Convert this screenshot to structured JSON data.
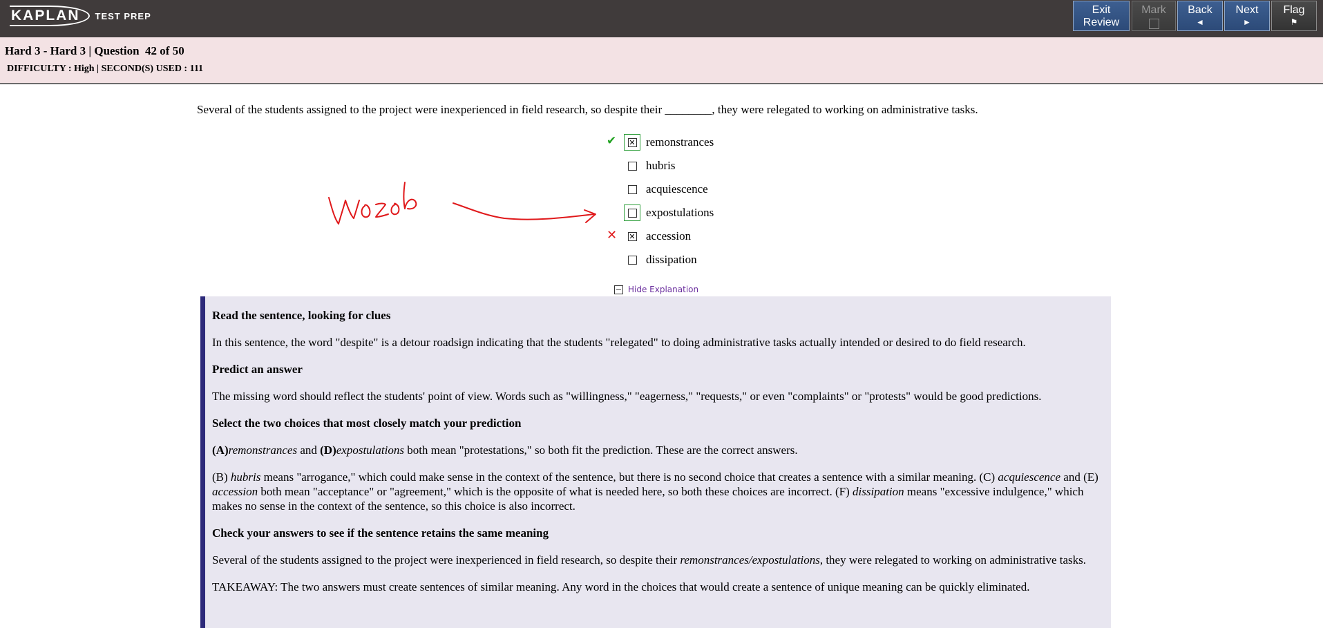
{
  "logo": {
    "main": "KAPLAN",
    "sub": "TEST PREP"
  },
  "toolbar": {
    "exit_line1": "Exit",
    "exit_line2": "Review",
    "mark": "Mark",
    "back": "Back",
    "back_icon": "◄",
    "next": "Next",
    "next_icon": "►",
    "flag": "Flag",
    "flag_icon": "⚑"
  },
  "info": {
    "title": "Hard 3 - Hard 3 | Question  42 of 50",
    "meta": "DIFFICULTY : High | SECOND(S) USED : 111"
  },
  "question": {
    "stem": "Several of the students assigned to the project were inexperienced in field research, so despite their ________, they were relegated to working on administrative tasks.",
    "choices": [
      {
        "label": "remonstrances",
        "checked": true,
        "status": "correct"
      },
      {
        "label": "hubris",
        "checked": false
      },
      {
        "label": "acquiescence",
        "checked": false
      },
      {
        "label": "expostulations",
        "checked": false,
        "status": "missed-correct"
      },
      {
        "label": "accession",
        "checked": true,
        "status": "wrong"
      },
      {
        "label": "dissipation",
        "checked": false
      }
    ],
    "correct_icon": "✔",
    "wrong_icon": "✕",
    "checked_glyph": "✕",
    "hide_explanation": "Hide Explanation",
    "minus_glyph": "−"
  },
  "explanation": {
    "h1": "Read the sentence, looking for clues",
    "p1": "In this sentence, the word \"despite\" is a detour roadsign indicating that the students \"relegated\" to doing administrative tasks actually intended or desired to do field research.",
    "h2": "Predict an answer",
    "p2": "The missing word should reflect the students' point of view. Words such as \"willingness,\" \"eagerness,\" \"requests,\" or even \"complaints\" or \"protests\" would be good predictions.",
    "h3": "Select the two choices that most closely match your prediction",
    "p3_a": "(A)",
    "p3_a_word": "remonstrances",
    "p3_and": " and ",
    "p3_d": "(D)",
    "p3_d_word": "expostulations",
    "p3_rest": " both mean \"protestations,\" so both fit the prediction. These are the correct answers.",
    "p4_1": "(B) ",
    "p4_hubris": "hubris",
    "p4_2": " means \"arrogance,\" which could make sense in the context of the sentence, but there is no second choice that creates a sentence with a similar meaning. (C) ",
    "p4_acq": "acquiescence",
    "p4_3": " and (E) ",
    "p4_acc": "accession",
    "p4_4": " both mean \"acceptance\" or \"agreement,\" which is the opposite of what is needed here, so both these choices are incorrect. (F) ",
    "p4_dis": "dissipation",
    "p4_5": " means \"excessive indulgence,\" which makes no sense in the context of the sentence, so this choice is also incorrect.",
    "h5": "Check your answers to see if the sentence retains the same meaning",
    "p5_1": "Several of the students assigned to the project were inexperienced in field research, so despite their ",
    "p5_it": "remonstrances/expostulations",
    "p5_2": ", they were relegated to working on administrative tasks.",
    "p6": "TAKEAWAY: The two answers must create sentences of similar meaning. Any word in the choices that would create a sentence of unique meaning can be quickly eliminated."
  },
  "annotation": {
    "text": "wozob",
    "color": "#e0191b"
  }
}
